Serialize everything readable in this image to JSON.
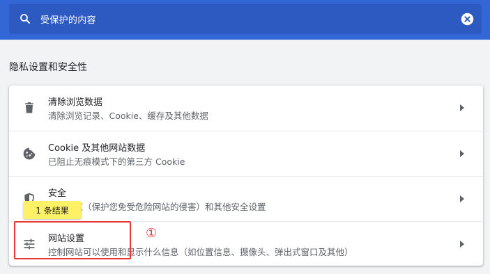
{
  "search": {
    "query": "受保护的内容"
  },
  "section": {
    "title": "隐私设置和安全性"
  },
  "rows": [
    {
      "title": "清除浏览数据",
      "subtitle": "清除浏览记录、Cookie、缓存及其他数据",
      "icon": "trash-icon"
    },
    {
      "title": "Cookie 及其他网站数据",
      "subtitle": "已阻止无痕模式下的第三方 Cookie",
      "icon": "cookie-icon"
    },
    {
      "title": "安全",
      "subtitle": "安全浏览（保护您免受危险网站的侵害）和其他安全设置",
      "icon": "shield-icon"
    },
    {
      "title": "网站设置",
      "subtitle": "控制网站可以使用和显示什么信息（如位置信息、摄像头、弹出式窗口及其他）",
      "icon": "tune-icon"
    }
  ],
  "tooltip": {
    "text": "1 条结果"
  },
  "annotation": {
    "marker": "①"
  },
  "colors": {
    "header": "#3367d6",
    "search_box": "#2c5ac1",
    "highlight": "#e53935",
    "tooltip": "#fef165"
  }
}
